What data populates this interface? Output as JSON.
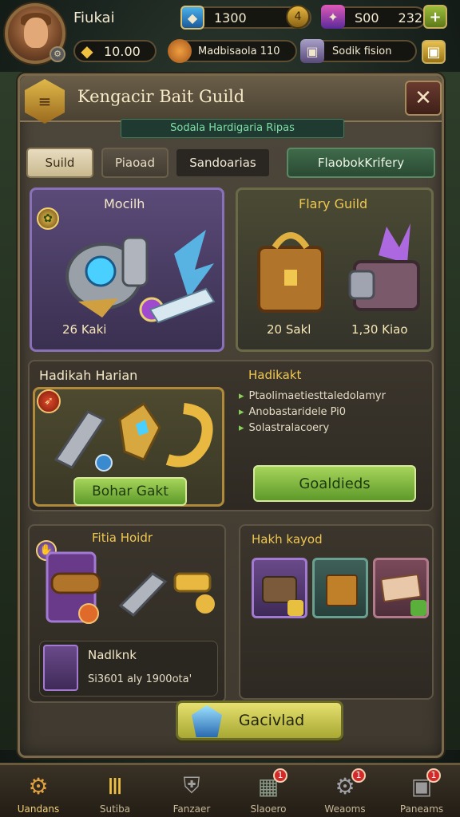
{
  "player": {
    "name": "Fiukai"
  },
  "resources": {
    "gems": "1300",
    "level": "4",
    "crystals": "S00",
    "energy": "232",
    "gold": "10.00",
    "guild_coin_label": "Madbisaola 110",
    "scroll_label": "Sodik  fision"
  },
  "panel": {
    "title": "Kengacir Bait Guild",
    "subtitle": "Sodala  Hardigaria Ripas",
    "close": "✕"
  },
  "tabs": [
    {
      "label": "Suild"
    },
    {
      "label": "Piaoad"
    },
    {
      "label": "Sandoarias"
    },
    {
      "label": "FlaobokKrifery"
    }
  ],
  "cards": {
    "top_left": {
      "title": "Mocilh",
      "price": "26 Kaki"
    },
    "top_right": {
      "title": "Flary Guild",
      "price_left": "20 Sakl",
      "price_right": "1,30 Kiao"
    },
    "mid_left": {
      "title": "Hadikah Harian",
      "button": "Bohar Gakt"
    },
    "mid_right": {
      "title": "Hadikakt",
      "lines": [
        "Ptaolimaetiesttaledolamyr",
        "Anobastaridele Pi0",
        "Solastralacoery"
      ],
      "button": "Goaldieds"
    },
    "bottom_left": {
      "title": "Fitia Hoidr",
      "sub_title": "Nadlknk",
      "sub_text": "Si3601 aly 1900ota'"
    },
    "bottom_right": {
      "title": "Hakh kayod"
    }
  },
  "bottom_button": {
    "label": "Gacivlad"
  },
  "nav": [
    {
      "label": "Uandans"
    },
    {
      "label": "Sutiba"
    },
    {
      "label": "Fanzaer"
    },
    {
      "label": "Slaoero",
      "badge": "1"
    },
    {
      "label": "Weaoms",
      "badge": "1"
    },
    {
      "label": "Paneams",
      "badge": "1"
    }
  ]
}
